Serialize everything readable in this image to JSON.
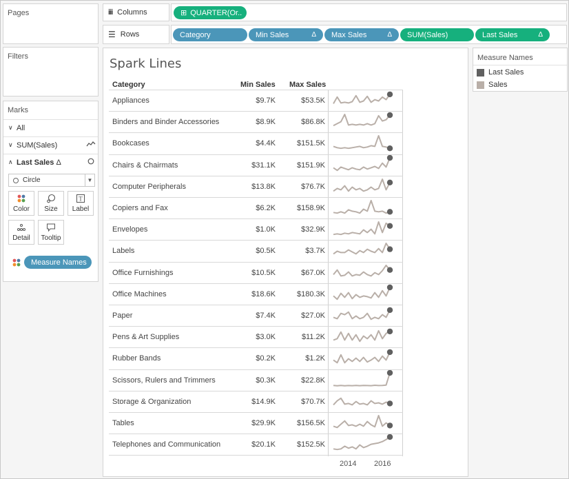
{
  "pages": {
    "title": "Pages"
  },
  "filters": {
    "title": "Filters"
  },
  "marks": {
    "title": "Marks",
    "rows": [
      {
        "label": "All",
        "icon": ""
      },
      {
        "label": "SUM(Sales)",
        "icon": "line-icon"
      },
      {
        "label": "Last Sales",
        "icon": "circle-icon",
        "delta": "Δ"
      }
    ],
    "mark_type": "Circle",
    "buttons": [
      "Color",
      "Size",
      "Label",
      "Detail",
      "Tooltip"
    ],
    "color_pill": "Measure Names"
  },
  "shelves": {
    "columns_label": "Columns",
    "rows_label": "Rows",
    "columns_pills": [
      {
        "label": "QUARTER(Or..",
        "prefix": "⊞"
      }
    ],
    "rows_pills": [
      {
        "label": "Category",
        "color": "blue",
        "delta": ""
      },
      {
        "label": "Min Sales",
        "color": "blue",
        "delta": "Δ"
      },
      {
        "label": "Max Sales",
        "color": "blue",
        "delta": "Δ"
      },
      {
        "label": "SUM(Sales)",
        "color": "green",
        "delta": ""
      },
      {
        "label": "Last Sales",
        "color": "green",
        "delta": "Δ"
      }
    ]
  },
  "legend": {
    "title": "Measure Names",
    "items": [
      {
        "label": "Last Sales",
        "color": "#606060"
      },
      {
        "label": "Sales",
        "color": "#b9afa8"
      }
    ]
  },
  "chart_data": {
    "type": "table",
    "title": "Spark Lines",
    "columns": [
      "Category",
      "Min Sales",
      "Max Sales"
    ],
    "x_axis_ticks": [
      "2014",
      "2016"
    ],
    "series_colors": {
      "sales": "#b9afa8",
      "last_sales": "#606060"
    },
    "rows": [
      {
        "category": "Appliances",
        "min": "$9.7K",
        "max": "$53.5K",
        "spark": [
          0.2,
          0.7,
          0.25,
          0.3,
          0.25,
          0.35,
          0.8,
          0.3,
          0.4,
          0.75,
          0.3,
          0.5,
          0.4,
          0.7,
          0.5,
          0.9
        ]
      },
      {
        "category": "Binders and Binder Accessories",
        "min": "$8.9K",
        "max": "$86.8K",
        "spark": [
          0.15,
          0.3,
          0.45,
          1.0,
          0.2,
          0.25,
          0.2,
          0.25,
          0.2,
          0.3,
          0.2,
          0.3,
          0.9,
          0.5,
          0.6,
          0.95
        ]
      },
      {
        "category": "Bookcases",
        "min": "$4.4K",
        "max": "$151.5K",
        "spark": [
          0.2,
          0.1,
          0.05,
          0.1,
          0.05,
          0.1,
          0.15,
          0.2,
          0.1,
          0.15,
          0.25,
          0.2,
          1.0,
          0.2,
          0.15,
          0.05
        ]
      },
      {
        "category": "Chairs & Chairmats",
        "min": "$31.1K",
        "max": "$151.9K",
        "spark": [
          0.25,
          0.05,
          0.3,
          0.2,
          0.1,
          0.25,
          0.15,
          0.1,
          0.3,
          0.15,
          0.25,
          0.35,
          0.2,
          0.6,
          0.3,
          1.0
        ]
      },
      {
        "category": "Computer Peripherals",
        "min": "$13.8K",
        "max": "$76.7K",
        "spark": [
          0.1,
          0.3,
          0.2,
          0.5,
          0.1,
          0.4,
          0.2,
          0.3,
          0.1,
          0.2,
          0.4,
          0.2,
          0.3,
          1.0,
          0.2,
          0.75
        ]
      },
      {
        "category": "Copiers and Fax",
        "min": "$6.2K",
        "max": "$158.9K",
        "spark": [
          0.1,
          0.05,
          0.15,
          0.05,
          0.3,
          0.2,
          0.15,
          0.05,
          0.35,
          0.2,
          1.0,
          0.2,
          0.15,
          0.2,
          0.05,
          0.15
        ]
      },
      {
        "category": "Envelopes",
        "min": "$1.0K",
        "max": "$32.9K",
        "spark": [
          0.05,
          0.1,
          0.05,
          0.15,
          0.1,
          0.2,
          0.15,
          0.1,
          0.4,
          0.2,
          0.45,
          0.1,
          1.0,
          0.2,
          0.9,
          0.7
        ]
      },
      {
        "category": "Labels",
        "min": "$0.5K",
        "max": "$3.7K",
        "spark": [
          0.2,
          0.4,
          0.3,
          0.3,
          0.5,
          0.35,
          0.2,
          0.45,
          0.3,
          0.55,
          0.4,
          0.3,
          0.6,
          0.3,
          1.0,
          0.55
        ]
      },
      {
        "category": "Office Furnishings",
        "min": "$10.5K",
        "max": "$67.0K",
        "spark": [
          0.3,
          0.65,
          0.2,
          0.25,
          0.5,
          0.2,
          0.3,
          0.25,
          0.5,
          0.3,
          0.2,
          0.45,
          0.3,
          0.6,
          1.0,
          0.65
        ]
      },
      {
        "category": "Office Machines",
        "min": "$18.6K",
        "max": "$180.3K",
        "spark": [
          0.3,
          0.05,
          0.5,
          0.2,
          0.55,
          0.1,
          0.4,
          0.2,
          0.3,
          0.25,
          0.15,
          0.55,
          0.2,
          0.7,
          0.3,
          0.95
        ]
      },
      {
        "category": "Paper",
        "min": "$7.4K",
        "max": "$27.0K",
        "spark": [
          0.3,
          0.2,
          0.6,
          0.5,
          0.7,
          0.2,
          0.4,
          0.2,
          0.3,
          0.6,
          0.15,
          0.3,
          0.2,
          0.5,
          0.3,
          0.85
        ]
      },
      {
        "category": "Pens & Art Supplies",
        "min": "$3.0K",
        "max": "$11.2K",
        "spark": [
          0.2,
          0.3,
          0.8,
          0.2,
          0.7,
          0.2,
          0.6,
          0.1,
          0.5,
          0.3,
          0.6,
          0.2,
          0.9,
          0.3,
          0.7,
          0.85
        ]
      },
      {
        "category": "Rubber Bands",
        "min": "$0.2K",
        "max": "$1.2K",
        "spark": [
          0.3,
          0.1,
          0.7,
          0.1,
          0.4,
          0.2,
          0.45,
          0.2,
          0.5,
          0.15,
          0.3,
          0.5,
          0.2,
          0.6,
          0.3,
          0.9
        ]
      },
      {
        "category": "Scissors, Rulers and Trimmers",
        "min": "$0.3K",
        "max": "$22.8K",
        "spark": [
          0.05,
          0.02,
          0.05,
          0.02,
          0.04,
          0.03,
          0.05,
          0.03,
          0.05,
          0.04,
          0.03,
          0.06,
          0.04,
          0.05,
          0.08,
          1.0
        ]
      },
      {
        "category": "Storage & Organization",
        "min": "$14.9K",
        "max": "$70.7K",
        "spark": [
          0.2,
          0.5,
          0.7,
          0.25,
          0.3,
          0.2,
          0.45,
          0.25,
          0.3,
          0.2,
          0.5,
          0.3,
          0.35,
          0.25,
          0.4,
          0.3
        ]
      },
      {
        "category": "Tables",
        "min": "$29.9K",
        "max": "$156.5K",
        "spark": [
          0.2,
          0.1,
          0.35,
          0.6,
          0.25,
          0.3,
          0.2,
          0.35,
          0.2,
          0.55,
          0.3,
          0.15,
          1.0,
          0.2,
          0.45,
          0.25
        ]
      },
      {
        "category": "Telephones and Communication",
        "min": "$20.1K",
        "max": "$152.5K",
        "spark": [
          0.1,
          0.05,
          0.1,
          0.3,
          0.15,
          0.25,
          0.1,
          0.4,
          0.2,
          0.3,
          0.45,
          0.5,
          0.55,
          0.65,
          0.8,
          1.0
        ]
      }
    ]
  }
}
